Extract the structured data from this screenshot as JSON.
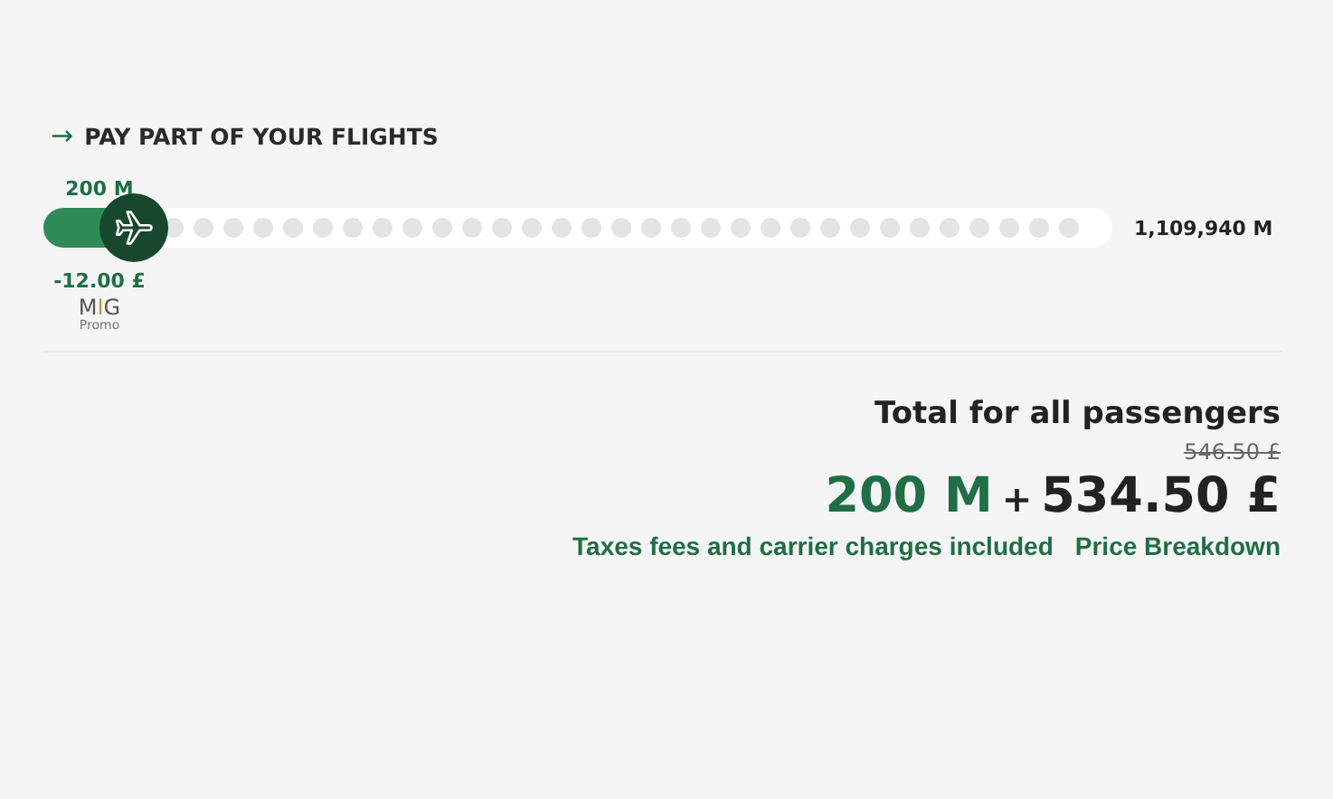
{
  "section": {
    "arrow": "→",
    "title": "PAY PART OF YOUR FLIGHTS"
  },
  "slider": {
    "value_label": "200 M",
    "level": 0.06,
    "max_label": "1,109,940 M",
    "discount": "-12.00 £"
  },
  "logo": {
    "text": "MIG",
    "sub": "Promo"
  },
  "total": {
    "heading": "Total for all passengers",
    "old_price": "546.50 £",
    "miles": "200 M",
    "plus": "+",
    "price": "534.50 £",
    "note": "Taxes fees and carrier charges included",
    "link": "Price Breakdown"
  }
}
